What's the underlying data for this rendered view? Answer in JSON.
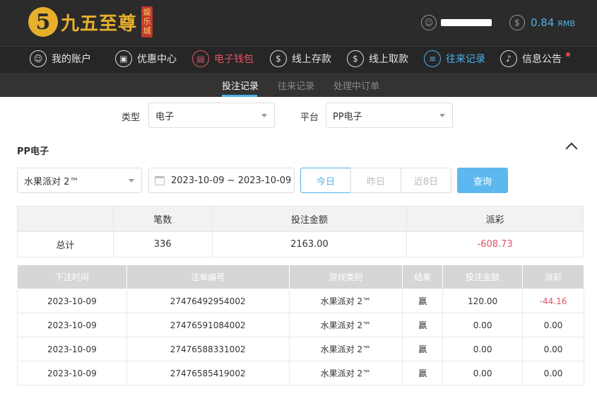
{
  "brand": {
    "badge": "5",
    "name": "九五至尊",
    "seal": "娱乐城"
  },
  "account": {
    "balance": "0.84",
    "currency": "RMB"
  },
  "nav": [
    {
      "label": "我的账户",
      "icon": "user-icon"
    },
    {
      "label": "优惠中心",
      "icon": "gift-icon"
    },
    {
      "label": "电子钱包",
      "icon": "wallet-icon"
    },
    {
      "label": "线上存款",
      "icon": "deposit-icon"
    },
    {
      "label": "线上取款",
      "icon": "withdraw-icon"
    },
    {
      "label": "往来记录",
      "icon": "records-icon"
    },
    {
      "label": "信息公告",
      "icon": "bell-icon"
    }
  ],
  "subnav": [
    "投注记录",
    "往来记录",
    "处理中订单"
  ],
  "filters": {
    "type_label": "类型",
    "type_value": "电子",
    "platform_label": "平台",
    "platform_value": "PP电子"
  },
  "section_title": "PP电子",
  "game_select": "水果派对 2™",
  "date_range": "2023-10-09 ~ 2023-10-09",
  "segments": [
    "今日",
    "昨日",
    "近8日"
  ],
  "query_label": "查询",
  "summary": {
    "headers": [
      "",
      "笔数",
      "投注金额",
      "派彩"
    ],
    "row": [
      "总计",
      "336",
      "2163.00",
      "-608.73"
    ]
  },
  "details": {
    "headers": [
      "下注时间",
      "注单编号",
      "游戏类别",
      "结果",
      "投注金额",
      "派彩"
    ],
    "rows": [
      [
        "2023-10-09",
        "27476492954002",
        "水果派对 2™",
        "赢",
        "120.00",
        "-44.16"
      ],
      [
        "2023-10-09",
        "27476591084002",
        "水果派对 2™",
        "赢",
        "0.00",
        "0.00"
      ],
      [
        "2023-10-09",
        "27476588331002",
        "水果派对 2™",
        "赢",
        "0.00",
        "0.00"
      ],
      [
        "2023-10-09",
        "27476585419002",
        "水果派对 2™",
        "赢",
        "0.00",
        "0.00"
      ]
    ]
  },
  "colors": {
    "accent": "#4fb0e8",
    "negative": "#e05466",
    "gold": "#e8b02a"
  }
}
